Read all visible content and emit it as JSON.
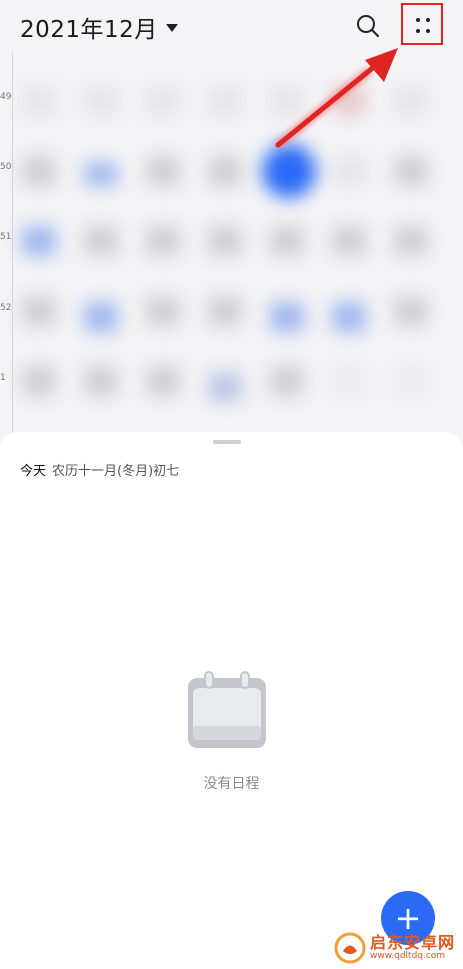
{
  "header": {
    "month_title": "2021年12月"
  },
  "week_numbers": [
    "49",
    "50",
    "51",
    "52",
    "1"
  ],
  "today_panel": {
    "today_label": "今天",
    "lunar_date": "农历十一月(冬月)初七",
    "empty_message": "没有日程"
  },
  "fab": {
    "label": "+"
  },
  "watermark": {
    "name": "启东安卓网",
    "url": "www.qdltdq.com"
  },
  "colors": {
    "accent": "#2a6af5",
    "annotation_red": "#e02424",
    "background": "#f4f4f6"
  },
  "icons": [
    "chevron-down-icon",
    "search-icon",
    "more-options-icon",
    "calendar-empty-icon",
    "plus-icon"
  ]
}
